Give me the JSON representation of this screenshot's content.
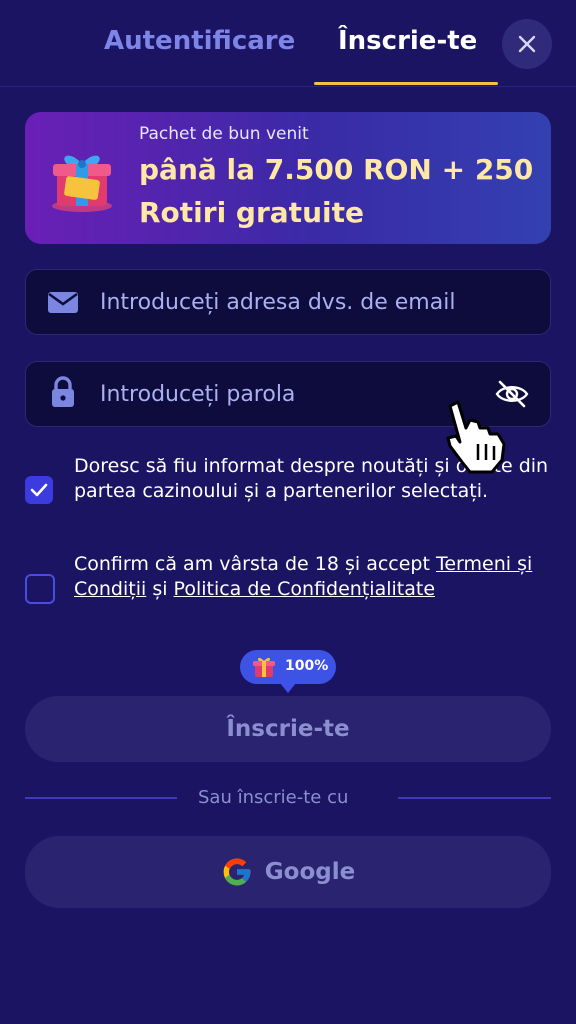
{
  "tabs": {
    "login": "Autentificare",
    "signup": "Înscrie-te"
  },
  "banner": {
    "subtitle": "Pachet de bun venit",
    "title": "până la 7.500 RON + 250 Rotiri gratuite"
  },
  "form": {
    "email_placeholder": "Introduceți adresa dvs. de email",
    "password_placeholder": "Introduceți parola"
  },
  "consents": {
    "news_text": "Doresc să fiu informat despre noutăți și oferte din partea cazinoului și a partenerilor selectați.",
    "news_checked": true,
    "age_prefix": "Confirm că am vârsta de 18 și accept ",
    "terms_link": "Termeni și Condiții",
    "age_and": " și ",
    "privacy_link": "Politica de Confidențialitate",
    "age_checked": false
  },
  "progress_badge": "100%",
  "buttons": {
    "signup": "Înscrie-te",
    "divider": "Sau înscrie-te cu",
    "google": "Google"
  },
  "colors": {
    "background": "#1b1463",
    "accent": "#f6c23e",
    "checkbox": "#3b3be0",
    "badge": "#3d53e6"
  },
  "icons": [
    "close-icon",
    "gift-icon",
    "email-icon",
    "lock-icon",
    "eye-off-icon",
    "check-icon",
    "google-icon",
    "hand-cursor-icon"
  ]
}
